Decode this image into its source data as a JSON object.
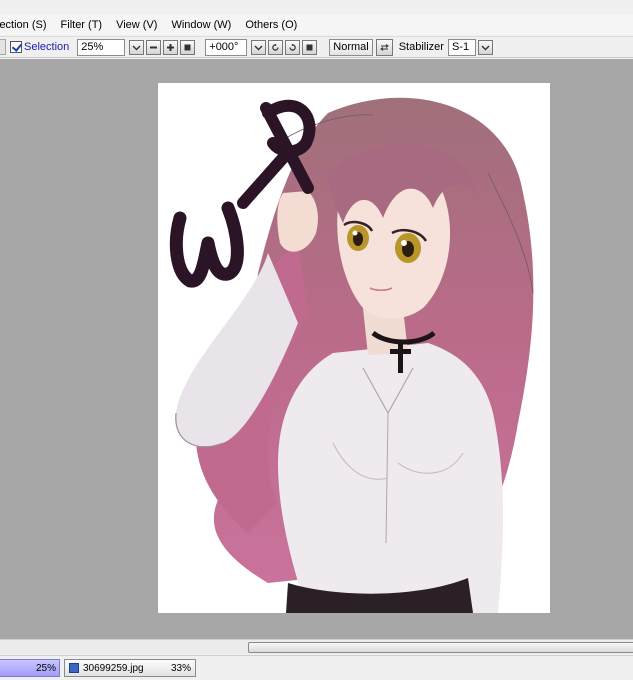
{
  "menu": {
    "items": [
      {
        "id": "selection",
        "label": "lection (S)"
      },
      {
        "id": "filter",
        "label": "Filter (T)"
      },
      {
        "id": "view",
        "label": "View (V)"
      },
      {
        "id": "window",
        "label": "Window (W)"
      },
      {
        "id": "others",
        "label": "Others (O)"
      }
    ]
  },
  "toolbar": {
    "selection_label": "Selection",
    "selection_checked": true,
    "zoom_value": "25%",
    "rotation_value": "+000°",
    "blend_mode": "Normal",
    "stabilizer_label": "Stabilizer",
    "stabilizer_value": "S-1"
  },
  "canvas": {
    "text_overlay": "WIP"
  },
  "status": {
    "zoom_percent": "25%",
    "document_name": "30699259.jpg",
    "document_zoom": "33%"
  },
  "colors": {
    "workspace": "#a7a7a7",
    "zoom_bar": "#a19dfa",
    "hair": "#b9627f",
    "wip_stroke": "#2a1426"
  }
}
